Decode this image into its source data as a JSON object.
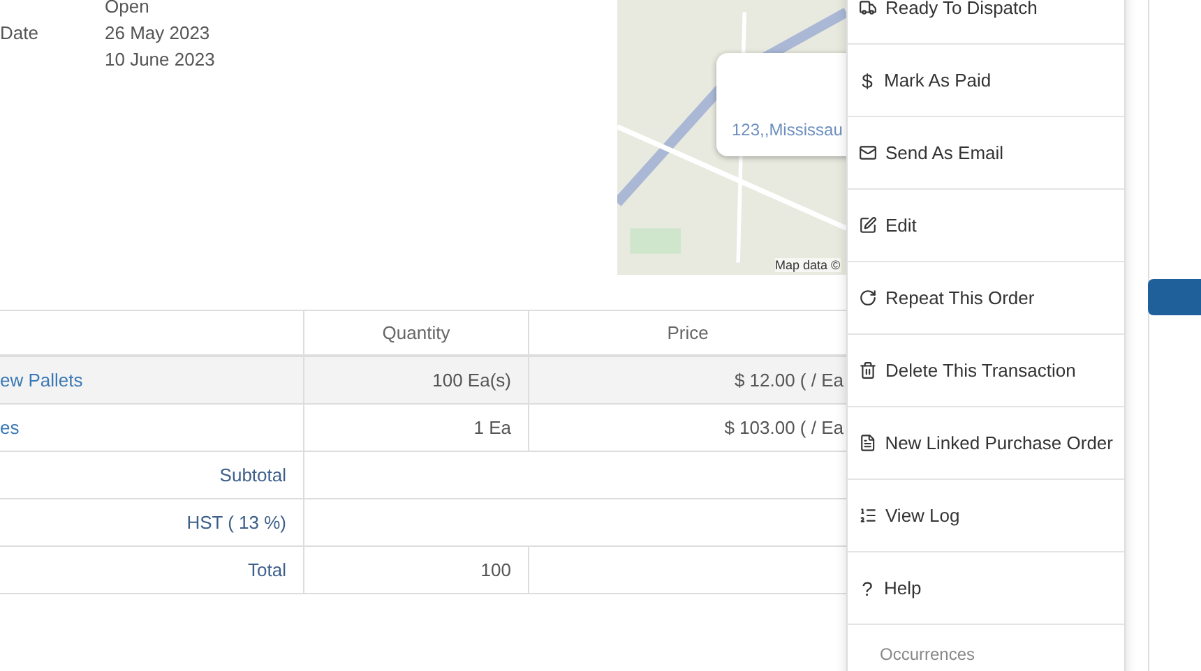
{
  "details": [
    {
      "value": "Open"
    },
    {
      "label": "Date",
      "value": "26 May 2023"
    },
    {
      "value": "10 June 2023"
    }
  ],
  "map": {
    "info_text": "123,,Mississau",
    "attribution": "Map data ©"
  },
  "table": {
    "columns": [
      "",
      "Quantity",
      "Price"
    ],
    "rows": [
      {
        "item": "ew Pallets",
        "quantity": "100 Ea(s)",
        "price": "$ 12.00 ( / Ea",
        "selected": true
      },
      {
        "item": "es",
        "quantity": "1 Ea",
        "price": "$ 103.00 ( / Ea",
        "selected": false
      }
    ],
    "summary": [
      {
        "label": "Subtotal"
      },
      {
        "label": "HST ( 13 %)"
      },
      {
        "label": "Total",
        "quantity": "100"
      }
    ]
  },
  "menu": {
    "items": [
      {
        "kind": "truck",
        "label": "Ready To Dispatch"
      },
      {
        "kind": "char",
        "icon": "$",
        "label": "Mark As Paid"
      },
      {
        "kind": "mail",
        "label": "Send As Email"
      },
      {
        "kind": "edit",
        "label": "Edit"
      },
      {
        "kind": "repeat",
        "label": "Repeat This Order"
      },
      {
        "kind": "trash",
        "label": "Delete This Transaction"
      },
      {
        "kind": "doc",
        "label": "New Linked Purchase Order"
      },
      {
        "kind": "list",
        "label": "View Log"
      },
      {
        "kind": "char",
        "icon": "?",
        "label": "Help"
      }
    ],
    "section": "Occurrences"
  }
}
